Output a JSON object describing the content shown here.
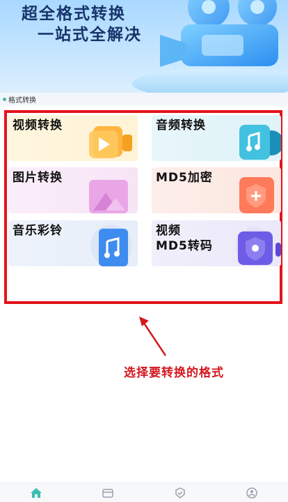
{
  "banner": {
    "title_line1": "超全格式转换",
    "title_line2": "一站式全解决"
  },
  "section": {
    "label": "格式转换"
  },
  "cards": {
    "video": {
      "label": "视频转换",
      "icon": "video-play-icon"
    },
    "audio": {
      "label": "音频转换",
      "icon": "music-note-icon"
    },
    "image": {
      "label": "图片转换",
      "icon": "image-icon"
    },
    "md5": {
      "label": "MD5加密",
      "icon": "shield-lock-icon"
    },
    "music": {
      "label": "音乐彩铃",
      "icon": "music-note-icon"
    },
    "video_md5": {
      "label_line1": "视频",
      "label_line2": "MD5转码",
      "icon": "shield-icon"
    }
  },
  "annotation": {
    "hint": "选择要转换的格式",
    "color": "#e4121a"
  },
  "bottom_nav": {
    "items": [
      "home-icon",
      "folder-icon",
      "tools-icon",
      "profile-icon"
    ],
    "active_color": "#3bbfb0"
  },
  "colors": {
    "banner_title": "#17346a",
    "accent": "#3bbfb0"
  }
}
